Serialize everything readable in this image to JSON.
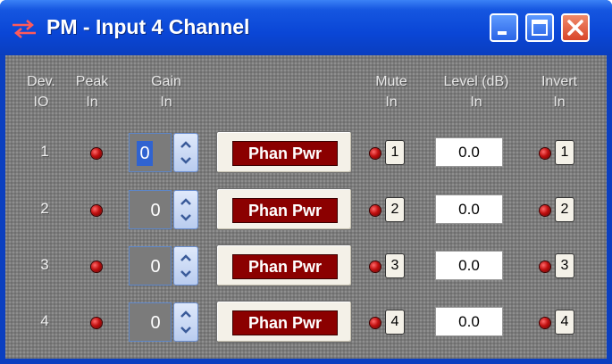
{
  "window": {
    "title": "PM - Input 4 Channel",
    "icon": "arrows-exchange-icon"
  },
  "headers": {
    "dev": [
      "Dev.",
      "IO"
    ],
    "peak": [
      "Peak",
      "In"
    ],
    "gain": [
      "Gain",
      "In"
    ],
    "mute": [
      "Mute",
      "In"
    ],
    "level": [
      "Level (dB)",
      "In"
    ],
    "invert": [
      "Invert",
      "In"
    ]
  },
  "rows": [
    {
      "io": "1",
      "gain": "0",
      "phan_label": "Phan Pwr",
      "mute_label": "1",
      "level": "0.0",
      "invert_label": "1"
    },
    {
      "io": "2",
      "gain": "0",
      "phan_label": "Phan Pwr",
      "mute_label": "2",
      "level": "0.0",
      "invert_label": "2"
    },
    {
      "io": "3",
      "gain": "0",
      "phan_label": "Phan Pwr",
      "mute_label": "3",
      "level": "0.0",
      "invert_label": "3"
    },
    {
      "io": "4",
      "gain": "0",
      "phan_label": "Phan Pwr",
      "mute_label": "4",
      "level": "0.0",
      "invert_label": "4"
    }
  ],
  "colors": {
    "led": "#c01010",
    "phan_bg": "#8b0000",
    "client_bg": "#7b7b7b",
    "titlebar": "#0a46d6"
  }
}
